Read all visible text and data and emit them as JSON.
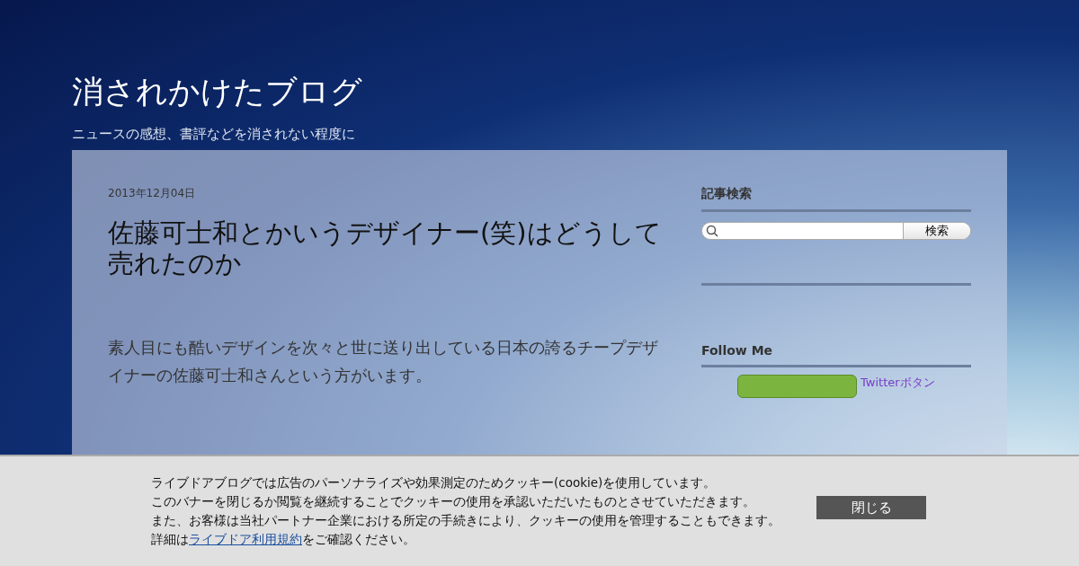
{
  "blog": {
    "title": "消されかけたブログ",
    "tagline": "ニュースの感想、書評などを消されない程度に"
  },
  "post": {
    "date": "2013年12月04日",
    "title": "佐藤可士和とかいうデザイナー(笑)はどうして売れたのか",
    "body": "素人目にも酷いデザインを次々と世に送り出している日本の誇るチープデザイナーの佐藤可士和さんという方がいます。"
  },
  "sidebar": {
    "search": {
      "heading": "記事検索",
      "button": "検索"
    },
    "follow": {
      "heading": "Follow Me",
      "image_alt": "Twitterボタン"
    }
  },
  "cookie_banner": {
    "lines": [
      "ライブドアブログでは広告のパーソナライズや効果測定のためクッキー(cookie)を使用しています。",
      "このバナーを閉じるか閲覧を継続することでクッキーの使用を承認いただいたものとさせていただきます。",
      "また、お客様は当社パートナー企業における所定の手続きにより、クッキーの使用を管理することもできます。"
    ],
    "details_before": "詳細は",
    "details_link": "ライブドア利用規約",
    "details_after": "をご確認ください。",
    "close_button": "閉じる"
  }
}
